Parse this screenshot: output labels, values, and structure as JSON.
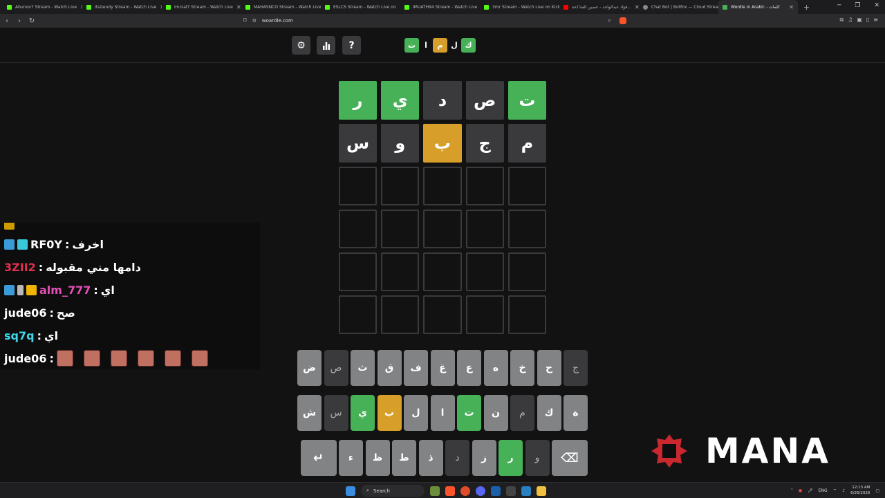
{
  "browser": {
    "tabs": [
      {
        "title": "Abunoo7 Stream - Watch Live",
        "icon": "kick-icon"
      },
      {
        "title": "ItsGendy Stream - Watch Live",
        "icon": "kick-icon"
      },
      {
        "title": "Imrsal7 Stream - Watch Live",
        "icon": "kick-icon"
      },
      {
        "title": "MAHASNCO Stream - Watch Live",
        "icon": "kick-icon"
      },
      {
        "title": "ESLCS Stream - Watch Live on",
        "icon": "kick-icon"
      },
      {
        "title": "IMUATH94 Stream - Watch Live",
        "icon": "kick-icon"
      },
      {
        "title": "3mr Stream - Watch Live on Kick",
        "icon": "kick-icon"
      },
      {
        "title": "فؤاد عبدالواحد - عصين الفنا (حة...",
        "icon": "youtube-icon"
      },
      {
        "title": "Chat Bot | BotRix — Cloud Stream",
        "icon": "botrix-icon"
      },
      {
        "title": "Wordle in Arabic - كلمات",
        "icon": "woardle-icon"
      }
    ],
    "url": "woardle.com"
  },
  "game": {
    "logo": [
      {
        "char": "ك",
        "state": "green"
      },
      {
        "char": "ل",
        "state": "plain"
      },
      {
        "char": "م",
        "state": "yellow"
      },
      {
        "char": "ا",
        "state": "plain"
      },
      {
        "char": "ت",
        "state": "green"
      }
    ],
    "header_buttons": [
      "gear-icon",
      "stats-icon",
      "help-icon"
    ],
    "help_label": "?",
    "grid": [
      [
        {
          "l": "ت",
          "s": "g"
        },
        {
          "l": "ص",
          "s": "d"
        },
        {
          "l": "د",
          "s": "d"
        },
        {
          "l": "ي",
          "s": "g"
        },
        {
          "l": "ر",
          "s": "g"
        }
      ],
      [
        {
          "l": "م",
          "s": "d"
        },
        {
          "l": "ج",
          "s": "d"
        },
        {
          "l": "ب",
          "s": "y"
        },
        {
          "l": "و",
          "s": "d"
        },
        {
          "l": "س",
          "s": "d"
        }
      ],
      [
        {
          "l": "",
          "s": ""
        },
        {
          "l": "",
          "s": ""
        },
        {
          "l": "",
          "s": ""
        },
        {
          "l": "",
          "s": ""
        },
        {
          "l": "",
          "s": ""
        }
      ],
      [
        {
          "l": "",
          "s": ""
        },
        {
          "l": "",
          "s": ""
        },
        {
          "l": "",
          "s": ""
        },
        {
          "l": "",
          "s": ""
        },
        {
          "l": "",
          "s": ""
        }
      ],
      [
        {
          "l": "",
          "s": ""
        },
        {
          "l": "",
          "s": ""
        },
        {
          "l": "",
          "s": ""
        },
        {
          "l": "",
          "s": ""
        },
        {
          "l": "",
          "s": ""
        }
      ],
      [
        {
          "l": "",
          "s": ""
        },
        {
          "l": "",
          "s": ""
        },
        {
          "l": "",
          "s": ""
        },
        {
          "l": "",
          "s": ""
        },
        {
          "l": "",
          "s": ""
        }
      ]
    ],
    "keyboard": [
      [
        {
          "k": "ج",
          "s": "a"
        },
        {
          "k": "ح",
          "s": ""
        },
        {
          "k": "خ",
          "s": ""
        },
        {
          "k": "ه",
          "s": ""
        },
        {
          "k": "ع",
          "s": ""
        },
        {
          "k": "غ",
          "s": ""
        },
        {
          "k": "ف",
          "s": ""
        },
        {
          "k": "ق",
          "s": ""
        },
        {
          "k": "ث",
          "s": ""
        },
        {
          "k": "ص",
          "s": "a"
        },
        {
          "k": "ض",
          "s": ""
        }
      ],
      [
        {
          "k": "ة",
          "s": ""
        },
        {
          "k": "ك",
          "s": ""
        },
        {
          "k": "م",
          "s": "a"
        },
        {
          "k": "ن",
          "s": ""
        },
        {
          "k": "ت",
          "s": "g"
        },
        {
          "k": "ا",
          "s": ""
        },
        {
          "k": "ل",
          "s": ""
        },
        {
          "k": "ب",
          "s": "y"
        },
        {
          "k": "ي",
          "s": "g"
        },
        {
          "k": "س",
          "s": "a"
        },
        {
          "k": "ش",
          "s": ""
        }
      ],
      [
        {
          "k": "⌫",
          "s": "",
          "wide": true,
          "name": "backspace-key"
        },
        {
          "k": "و",
          "s": "a"
        },
        {
          "k": "ر",
          "s": "g"
        },
        {
          "k": "ز",
          "s": ""
        },
        {
          "k": "د",
          "s": "a"
        },
        {
          "k": "ذ",
          "s": ""
        },
        {
          "k": "ط",
          "s": ""
        },
        {
          "k": "ظ",
          "s": ""
        },
        {
          "k": "ء",
          "s": ""
        },
        {
          "k": "↵",
          "s": "",
          "wide": true,
          "name": "enter-key"
        }
      ]
    ]
  },
  "chat": [
    {
      "user": "RF0Y",
      "user_color": "#ffffff",
      "msg": "اخرف",
      "badges": [
        "b1",
        "b2"
      ]
    },
    {
      "user": "3ZII2",
      "user_color": "#e0304f",
      "msg": "دامها مني مقبوله",
      "badges": []
    },
    {
      "user": "alm_777",
      "user_color": "#e54fb8",
      "msg": "اي",
      "badges": [
        "b1",
        "b3",
        "b4"
      ]
    },
    {
      "user": "jude06",
      "user_color": "#ffffff",
      "msg": "صح",
      "badges": []
    },
    {
      "user": "sq7q",
      "user_color": "#3fd6e8",
      "msg": "اي",
      "badges": []
    },
    {
      "user": "jude06",
      "user_color": "#ffffff",
      "msg": "",
      "emotes": 6,
      "badges": []
    }
  ],
  "overlay": {
    "brand": "MANA"
  },
  "taskbar": {
    "search": "Search",
    "lang": "ENG",
    "time": "12:13 AM",
    "date": "6/26/2026"
  },
  "colors": {
    "green": "#47b157",
    "yellow": "#d79f2a",
    "absent": "#3a3a3c",
    "key": "#818384",
    "bg": "#121213",
    "brand_red": "#c8282e"
  }
}
